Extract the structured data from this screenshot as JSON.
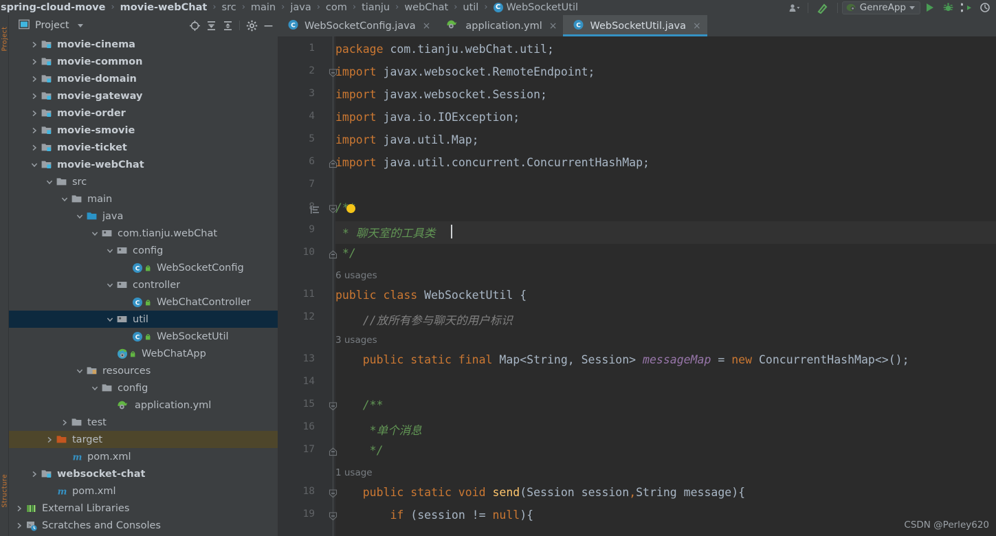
{
  "breadcrumb": {
    "items": [
      {
        "label": "spring-cloud-move",
        "bold": true,
        "icon": null
      },
      {
        "label": "movie-webChat",
        "bold": true,
        "icon": null
      },
      {
        "label": "src",
        "bold": false,
        "icon": null
      },
      {
        "label": "main",
        "bold": false,
        "icon": null
      },
      {
        "label": "java",
        "bold": false,
        "icon": null
      },
      {
        "label": "com",
        "bold": false,
        "icon": null
      },
      {
        "label": "tianju",
        "bold": false,
        "icon": null
      },
      {
        "label": "webChat",
        "bold": false,
        "icon": null
      },
      {
        "label": "util",
        "bold": false,
        "icon": null
      },
      {
        "label": "WebSocketUtil",
        "bold": false,
        "icon": "class-icon"
      }
    ],
    "separator": "›"
  },
  "toolbar": {
    "user_icon": "user-icon",
    "build_icon": "hammer-icon",
    "run_config_name": "GenreApp",
    "run_config_icon": "spring-boot-icon",
    "run_icon": "run-icon",
    "debug_icon": "debug-icon",
    "coverage_icon": "run-with-coverage-icon",
    "profile_icon": "profiler-icon"
  },
  "toolstrip": {
    "label_top": "Project",
    "label_bottom": "Structure"
  },
  "project_panel": {
    "title": "Project",
    "icons": [
      "project-view-icon",
      "locate-icon",
      "expand-all-icon",
      "collapse-all-icon",
      "settings-icon",
      "hide-icon"
    ],
    "tree": [
      {
        "label": "movie-cinema",
        "depth": 1,
        "arrow": "collapsed",
        "icon": "module-folder-icon",
        "bold": true
      },
      {
        "label": "movie-common",
        "depth": 1,
        "arrow": "collapsed",
        "icon": "module-folder-icon",
        "bold": true
      },
      {
        "label": "movie-domain",
        "depth": 1,
        "arrow": "collapsed",
        "icon": "module-folder-icon",
        "bold": true
      },
      {
        "label": "movie-gateway",
        "depth": 1,
        "arrow": "collapsed",
        "icon": "module-folder-icon",
        "bold": true
      },
      {
        "label": "movie-order",
        "depth": 1,
        "arrow": "collapsed",
        "icon": "module-folder-icon",
        "bold": true
      },
      {
        "label": "movie-smovie",
        "depth": 1,
        "arrow": "collapsed",
        "icon": "module-folder-icon",
        "bold": true
      },
      {
        "label": "movie-ticket",
        "depth": 1,
        "arrow": "collapsed",
        "icon": "module-folder-icon",
        "bold": true
      },
      {
        "label": "movie-webChat",
        "depth": 1,
        "arrow": "expanded",
        "icon": "module-folder-icon",
        "bold": true
      },
      {
        "label": "src",
        "depth": 2,
        "arrow": "expanded",
        "icon": "folder-icon",
        "bold": false
      },
      {
        "label": "main",
        "depth": 3,
        "arrow": "expanded",
        "icon": "folder-icon",
        "bold": false
      },
      {
        "label": "java",
        "depth": 4,
        "arrow": "expanded",
        "icon": "source-folder-icon",
        "bold": false
      },
      {
        "label": "com.tianju.webChat",
        "depth": 5,
        "arrow": "expanded",
        "icon": "package-icon",
        "bold": false
      },
      {
        "label": "config",
        "depth": 6,
        "arrow": "expanded",
        "icon": "package-icon",
        "bold": false
      },
      {
        "label": "WebSocketConfig",
        "depth": 7,
        "arrow": "none",
        "icon": "java-class-icon",
        "bold": false
      },
      {
        "label": "controller",
        "depth": 6,
        "arrow": "expanded",
        "icon": "package-icon",
        "bold": false
      },
      {
        "label": "WebChatController",
        "depth": 7,
        "arrow": "none",
        "icon": "java-class-icon",
        "bold": false
      },
      {
        "label": "util",
        "depth": 6,
        "arrow": "expanded",
        "icon": "package-icon",
        "bold": false,
        "selected": true
      },
      {
        "label": "WebSocketUtil",
        "depth": 7,
        "arrow": "none",
        "icon": "java-class-icon",
        "bold": false
      },
      {
        "label": "WebChatApp",
        "depth": 6,
        "arrow": "none",
        "icon": "spring-app-icon",
        "bold": false
      },
      {
        "label": "resources",
        "depth": 4,
        "arrow": "expanded",
        "icon": "resources-folder-icon",
        "bold": false
      },
      {
        "label": "config",
        "depth": 5,
        "arrow": "expanded",
        "icon": "folder-icon",
        "bold": false
      },
      {
        "label": "application.yml",
        "depth": 6,
        "arrow": "none",
        "icon": "spring-yml-icon",
        "bold": false
      },
      {
        "label": "test",
        "depth": 3,
        "arrow": "collapsed",
        "icon": "folder-icon",
        "bold": false
      },
      {
        "label": "target",
        "depth": 2,
        "arrow": "collapsed",
        "icon": "excluded-folder-icon",
        "bold": false,
        "highlighted": true
      },
      {
        "label": "pom.xml",
        "depth": 3,
        "arrow": "none",
        "icon": "maven-icon",
        "bold": false
      },
      {
        "label": "websocket-chat",
        "depth": 1,
        "arrow": "collapsed",
        "icon": "module-folder-icon",
        "bold": true
      },
      {
        "label": "pom.xml",
        "depth": 2,
        "arrow": "none",
        "icon": "maven-icon",
        "bold": false
      },
      {
        "label": "External Libraries",
        "depth": 0,
        "arrow": "collapsed",
        "icon": "libraries-icon",
        "bold": false
      },
      {
        "label": "Scratches and Consoles",
        "depth": 0,
        "arrow": "collapsed",
        "icon": "scratches-icon",
        "bold": false
      }
    ]
  },
  "editor": {
    "tabs": [
      {
        "label": "WebSocketConfig.java",
        "icon": "java-class-icon",
        "active": false,
        "close": "×"
      },
      {
        "label": "application.yml",
        "icon": "spring-yml-icon",
        "active": false,
        "close": "×"
      },
      {
        "label": "WebSocketUtil.java",
        "icon": "java-class-icon",
        "active": true,
        "close": "×"
      }
    ],
    "line_numbers": [
      "1",
      "2",
      "3",
      "4",
      "5",
      "6",
      "7",
      "8",
      "9",
      "10",
      "11",
      "12",
      "13",
      "14",
      "15",
      "16",
      "17",
      "18",
      "19"
    ],
    "lines": [
      {
        "num": "1",
        "tokens": [
          {
            "t": "package ",
            "c": "kw"
          },
          {
            "t": "com.tianju.webChat.util;",
            "c": "plain"
          }
        ]
      },
      {
        "num": "2",
        "tokens": [
          {
            "t": "import ",
            "c": "kw"
          },
          {
            "t": "javax.websocket.RemoteEndpoint;",
            "c": "plain"
          }
        ]
      },
      {
        "num": "3",
        "tokens": [
          {
            "t": "import ",
            "c": "kw"
          },
          {
            "t": "javax.websocket.Session;",
            "c": "plain"
          }
        ]
      },
      {
        "num": "4",
        "tokens": [
          {
            "t": "import ",
            "c": "kw"
          },
          {
            "t": "java.io.IOException;",
            "c": "plain"
          }
        ]
      },
      {
        "num": "5",
        "tokens": [
          {
            "t": "import ",
            "c": "kw"
          },
          {
            "t": "java.util.Map;",
            "c": "plain"
          }
        ]
      },
      {
        "num": "6",
        "tokens": [
          {
            "t": "import ",
            "c": "kw"
          },
          {
            "t": "java.util.concurrent.ConcurrentHashMap;",
            "c": "plain"
          }
        ]
      },
      {
        "num": "7",
        "tokens": []
      },
      {
        "num": "8",
        "tokens": [
          {
            "t": "/**",
            "c": "cmt"
          }
        ]
      },
      {
        "num": "9",
        "tokens": [
          {
            "t": " * 聊天室的工具类",
            "c": "cmt"
          }
        ]
      },
      {
        "num": "10",
        "tokens": [
          {
            "t": " */",
            "c": "cmt"
          }
        ]
      },
      {
        "num": "11",
        "tokens": [
          {
            "t": "public class ",
            "c": "kw"
          },
          {
            "t": "WebSocketUtil {",
            "c": "cls"
          }
        ]
      },
      {
        "num": "12",
        "tokens": [
          {
            "t": "    //放所有参与聊天的用户标识",
            "c": "cmt-line"
          }
        ]
      },
      {
        "num": "13",
        "tokens": [
          {
            "t": "    public static final ",
            "c": "kw"
          },
          {
            "t": "Map<String, Session> ",
            "c": "plain"
          },
          {
            "t": "messageMap",
            "c": "fld"
          },
          {
            "t": " = ",
            "c": "plain"
          },
          {
            "t": "new ",
            "c": "kw"
          },
          {
            "t": "ConcurrentHashMap<>();",
            "c": "plain"
          }
        ]
      },
      {
        "num": "14",
        "tokens": []
      },
      {
        "num": "15",
        "tokens": [
          {
            "t": "    /**",
            "c": "cmt"
          }
        ]
      },
      {
        "num": "16",
        "tokens": [
          {
            "t": "     *单个消息",
            "c": "cmt"
          }
        ]
      },
      {
        "num": "17",
        "tokens": [
          {
            "t": "     */",
            "c": "cmt"
          }
        ]
      },
      {
        "num": "18",
        "tokens": [
          {
            "t": "    public static void ",
            "c": "kw"
          },
          {
            "t": "send",
            "c": "mth"
          },
          {
            "t": "(Session session",
            "c": "plain"
          },
          {
            "t": ",",
            "c": "kw"
          },
          {
            "t": "String message){",
            "c": "plain"
          }
        ]
      },
      {
        "num": "19",
        "tokens": [
          {
            "t": "        if ",
            "c": "kw"
          },
          {
            "t": "(session != ",
            "c": "plain"
          },
          {
            "t": "null",
            "c": "kw"
          },
          {
            "t": "){",
            "c": "plain"
          }
        ]
      }
    ],
    "usage_hints": [
      {
        "text": "6 usages",
        "after_line": "10"
      },
      {
        "text": "3 usages",
        "after_line": "12"
      },
      {
        "text": "1 usage",
        "after_line": "17"
      }
    ],
    "intention_bulb": "lightbulb-icon"
  },
  "watermark": "CSDN @Perley620",
  "colors": {
    "editor_bg": "#2b2b2b",
    "panel_bg": "#3c3f41",
    "gutter_bg": "#313335",
    "selection_blue": "#0d293e",
    "accent_blue": "#3592c4",
    "keyword_orange": "#cc7832",
    "comment_green": "#629755",
    "field_purple": "#9876aa",
    "method_yellow": "#ffc66d",
    "text_gray": "#a9b7c6",
    "run_green": "#499c54"
  }
}
